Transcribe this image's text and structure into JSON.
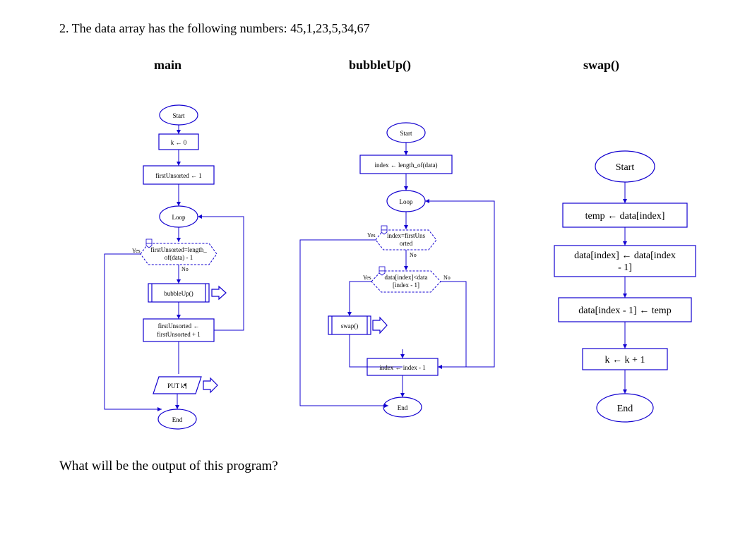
{
  "question_prefix": "2. The data array has the following numbers: 45,1,23,5,34,67",
  "question_suffix": "What will be the output of this program?",
  "columns": {
    "main": "main",
    "bubble": "bubbleUp()",
    "swap": "swap()"
  },
  "labels": {
    "yes": "Yes",
    "no": "No"
  },
  "main": {
    "start": "Start",
    "k0": "k ← 0",
    "fu1": "firstUnsorted ← 1",
    "loop": "Loop",
    "cond_a": "firstUnsorted=length_",
    "cond_b": "of(data) - 1",
    "call": "bubbleUp()",
    "incr_a": "firstUnsorted ←",
    "incr_b": "firstUnsorted + 1",
    "put": "PUT k¶",
    "end": "End"
  },
  "bubble": {
    "start": "Start",
    "idxlen": "index ← length_of(data)",
    "loop": "Loop",
    "cond1_a": "index=firstUns",
    "cond1_b": "orted",
    "cond2_a": "data[index]<data",
    "cond2_b": "[index - 1]",
    "call": "swap()",
    "decr": "index ← index - 1",
    "end": "End"
  },
  "swap": {
    "start": "Start",
    "s1": "temp ← data[index]",
    "s2_a": "data[index] ← data[index",
    "s2_b": "- 1]",
    "s3": "data[index - 1] ← temp",
    "s4": "k ← k + 1",
    "end": "End"
  }
}
